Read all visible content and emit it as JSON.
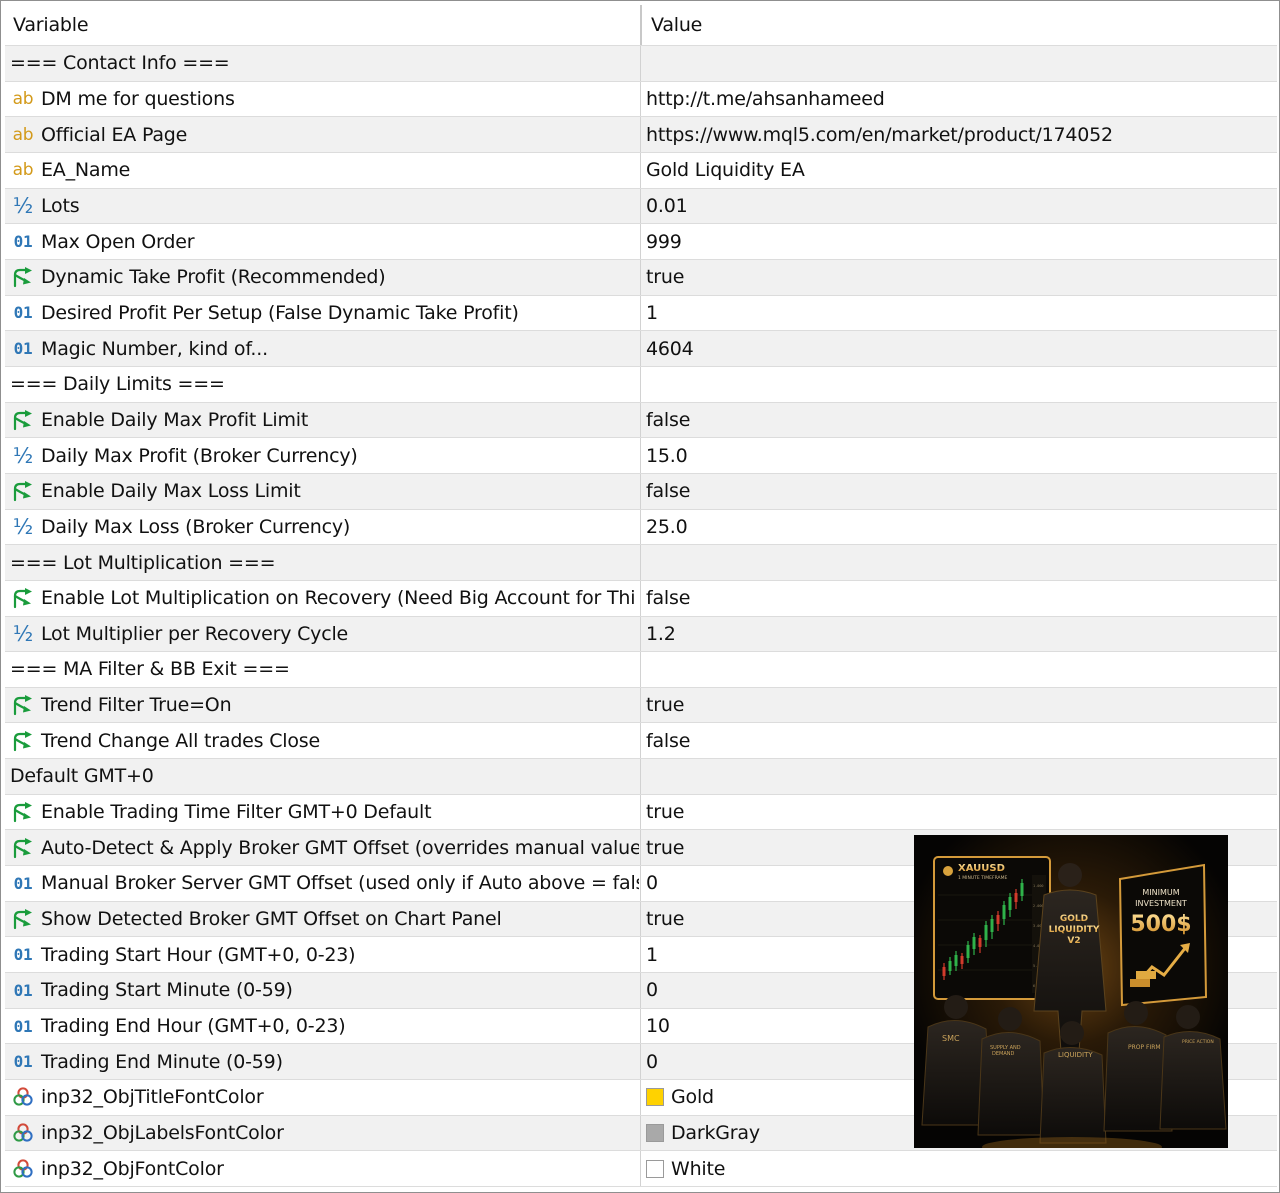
{
  "header": {
    "variable": "Variable",
    "value": "Value"
  },
  "rows": [
    {
      "type": "section",
      "variable": "=== Contact Info ===",
      "value": ""
    },
    {
      "type": "param",
      "icon": "string-icon",
      "variable": "DM me for questions",
      "value": "http://t.me/ahsanhameed"
    },
    {
      "type": "param",
      "icon": "string-icon",
      "variable": "Official EA Page",
      "value": "https://www.mql5.com/en/market/product/174052"
    },
    {
      "type": "param",
      "icon": "string-icon",
      "variable": "EA_Name",
      "value": "Gold Liquidity EA"
    },
    {
      "type": "param",
      "icon": "double-icon",
      "variable": "Lots",
      "value": "0.01"
    },
    {
      "type": "param",
      "icon": "integer-icon",
      "variable": "Max Open Order",
      "value": "999"
    },
    {
      "type": "param",
      "icon": "bool-icon",
      "variable": "Dynamic Take Profit (Recommended)",
      "value": "true"
    },
    {
      "type": "param",
      "icon": "integer-icon",
      "variable": "Desired Profit Per Setup (False Dynamic Take Profit)",
      "value": "1"
    },
    {
      "type": "param",
      "icon": "integer-icon",
      "variable": "Magic Number, kind of...",
      "value": "4604"
    },
    {
      "type": "section",
      "variable": "=== Daily Limits ===",
      "value": ""
    },
    {
      "type": "param",
      "icon": "bool-icon",
      "variable": "Enable Daily Max Profit Limit",
      "value": "false"
    },
    {
      "type": "param",
      "icon": "double-icon",
      "variable": "Daily Max Profit (Broker Currency)",
      "value": "15.0"
    },
    {
      "type": "param",
      "icon": "bool-icon",
      "variable": "Enable Daily Max Loss Limit",
      "value": "false"
    },
    {
      "type": "param",
      "icon": "double-icon",
      "variable": "Daily Max Loss (Broker Currency)",
      "value": "25.0"
    },
    {
      "type": "section",
      "variable": "=== Lot Multiplication ===",
      "value": ""
    },
    {
      "type": "param",
      "icon": "bool-icon",
      "variable": "Enable Lot Multiplication on Recovery (Need Big Account for Thi",
      "value": "false"
    },
    {
      "type": "param",
      "icon": "double-icon",
      "variable": "Lot Multiplier per Recovery Cycle",
      "value": "1.2"
    },
    {
      "type": "section",
      "variable": "=== MA Filter & BB Exit ===",
      "value": ""
    },
    {
      "type": "param",
      "icon": "bool-icon",
      "variable": "Trend Filter True=On",
      "value": "true"
    },
    {
      "type": "param",
      "icon": "bool-icon",
      "variable": "Trend Change All trades Close",
      "value": "false"
    },
    {
      "type": "section",
      "variable": "Default GMT+0",
      "value": ""
    },
    {
      "type": "param",
      "icon": "bool-icon",
      "variable": "Enable Trading Time Filter GMT+0 Default",
      "value": "true"
    },
    {
      "type": "param",
      "icon": "bool-icon",
      "variable": "Auto-Detect & Apply Broker GMT Offset (overrides manual value b",
      "value": "true"
    },
    {
      "type": "param",
      "icon": "integer-icon",
      "variable": "Manual Broker Server GMT Offset (used only if Auto above = fals",
      "value": "0"
    },
    {
      "type": "param",
      "icon": "bool-icon",
      "variable": "Show Detected Broker GMT Offset on Chart Panel",
      "value": "true"
    },
    {
      "type": "param",
      "icon": "integer-icon",
      "variable": "Trading Start Hour (GMT+0, 0-23)",
      "value": "1"
    },
    {
      "type": "param",
      "icon": "integer-icon",
      "variable": "Trading Start Minute (0-59)",
      "value": "0"
    },
    {
      "type": "param",
      "icon": "integer-icon",
      "variable": "Trading End Hour (GMT+0, 0-23)",
      "value": "10"
    },
    {
      "type": "param",
      "icon": "integer-icon",
      "variable": "Trading End Minute (0-59)",
      "value": "0"
    },
    {
      "type": "param",
      "icon": "color-icon",
      "variable": "inp32_ObjTitleFontColor",
      "value": "Gold",
      "swatch": "#ffd200"
    },
    {
      "type": "param",
      "icon": "color-icon",
      "variable": "inp32_ObjLabelsFontColor",
      "value": "DarkGray",
      "swatch": "#a9a9a9"
    },
    {
      "type": "param",
      "icon": "color-icon",
      "variable": "inp32_ObjFontColor",
      "value": "White",
      "swatch": "#ffffff"
    }
  ],
  "icon_glyphs": {
    "string": "ab",
    "double": "½",
    "integer": "01"
  },
  "promo": {
    "symbol": "XAUUSD",
    "timeframe": "1 MINUTE TIMEFRAME",
    "product_line1": "GOLD",
    "product_line2": "LIQUIDITY",
    "product_line3": "V2",
    "investment_label_line1": "MINIMUM",
    "investment_label_line2": "INVESTMENT",
    "investment_value": "500$",
    "tag_smc": "SMC",
    "tag_supply_line1": "SUPPLY AND",
    "tag_supply_line2": "DEMAND",
    "tag_liquidity": "LIQUIDITY",
    "tag_prop": "PROP FIRM",
    "tag_price": "PRICE ACTION",
    "accent_color": "#e3a53a"
  }
}
